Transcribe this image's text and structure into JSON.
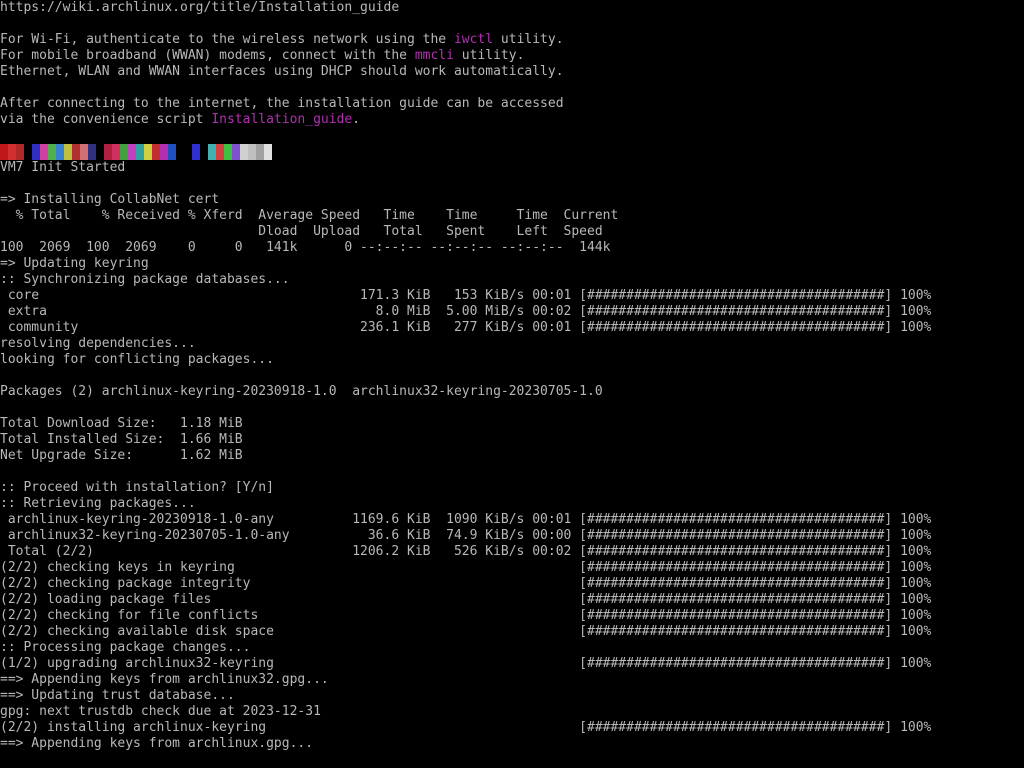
{
  "terminal": {
    "text_color": "#b8b8b8",
    "highlight_color": "#b030b0",
    "background": "#000000"
  },
  "motd": {
    "url": "https://wiki.archlinux.org/title/Installation_guide",
    "wifi_pre": "For Wi-Fi, authenticate to the wireless network using the ",
    "wifi_cmd": "iwctl",
    "wifi_post": " utility.",
    "wwan_pre": "For mobile broadband (WWAN) modems, connect with the ",
    "wwan_cmd": "mmcli",
    "wwan_post": " utility.",
    "dhcp": "Ethernet, WLAN and WWAN interfaces using DHCP should work automatically.",
    "guide_1": "After connecting to the internet, the installation guide can be accessed",
    "guide_2_pre": "via the convenience script ",
    "guide_2_cmd": "Installation_guide",
    "guide_2_post": "."
  },
  "color_bar_colors": [
    "#c01818",
    "#d03030",
    "#b02828",
    "#000000",
    "#3030c0",
    "#d040a0",
    "#50b050",
    "#3880d0",
    "#c0c040",
    "#b03030",
    "#d07070",
    "#303080",
    "#000000",
    "#b02040",
    "#d03060",
    "#40a040",
    "#c040c0",
    "#30a0a0",
    "#d0d040",
    "#c03030",
    "#b030b0",
    "#2050c0",
    "#000000",
    "#000000",
    "#3030d0",
    "#000000",
    "#40b0b0",
    "#d04040",
    "#40c040",
    "#8050d0",
    "#d0d0d0",
    "#c0c0c0",
    "#a0a0a0",
    "#e0e0e0"
  ],
  "lines": [
    "VM7 Init Started",
    "",
    "=> Installing CollabNet cert",
    "  % Total    % Received % Xferd  Average Speed   Time    Time     Time  Current",
    "                                 Dload  Upload   Total   Spent    Left  Speed",
    "100  2069  100  2069    0     0   141k      0 --:--:-- --:--:-- --:--:--  144k",
    "=> Updating keyring",
    ":: Synchronizing package databases...",
    " core                                         171.3 KiB   153 KiB/s 00:01 [######################################] 100%",
    " extra                                          8.0 MiB  5.00 MiB/s 00:02 [######################################] 100%",
    " community                                    236.1 KiB   277 KiB/s 00:01 [######################################] 100%",
    "resolving dependencies...",
    "looking for conflicting packages...",
    "",
    "Packages (2) archlinux-keyring-20230918-1.0  archlinux32-keyring-20230705-1.0",
    "",
    "Total Download Size:   1.18 MiB",
    "Total Installed Size:  1.66 MiB",
    "Net Upgrade Size:      1.62 MiB",
    "",
    ":: Proceed with installation? [Y/n]",
    ":: Retrieving packages...",
    " archlinux-keyring-20230918-1.0-any          1169.6 KiB  1090 KiB/s 00:01 [######################################] 100%",
    " archlinux32-keyring-20230705-1.0-any          36.6 KiB  74.9 KiB/s 00:00 [######################################] 100%",
    " Total (2/2)                                 1206.2 KiB   526 KiB/s 00:02 [######################################] 100%",
    "(2/2) checking keys in keyring                                            [######################################] 100%",
    "(2/2) checking package integrity                                          [######################################] 100%",
    "(2/2) loading package files                                               [######################################] 100%",
    "(2/2) checking for file conflicts                                         [######################################] 100%",
    "(2/2) checking available disk space                                       [######################################] 100%",
    ":: Processing package changes...",
    "(1/2) upgrading archlinux32-keyring                                       [######################################] 100%",
    "==> Appending keys from archlinux32.gpg...",
    "==> Updating trust database...",
    "gpg: next trustdb check due at 2023-12-31",
    "(2/2) installing archlinux-keyring                                        [######################################] 100%",
    "==> Appending keys from archlinux.gpg..."
  ]
}
